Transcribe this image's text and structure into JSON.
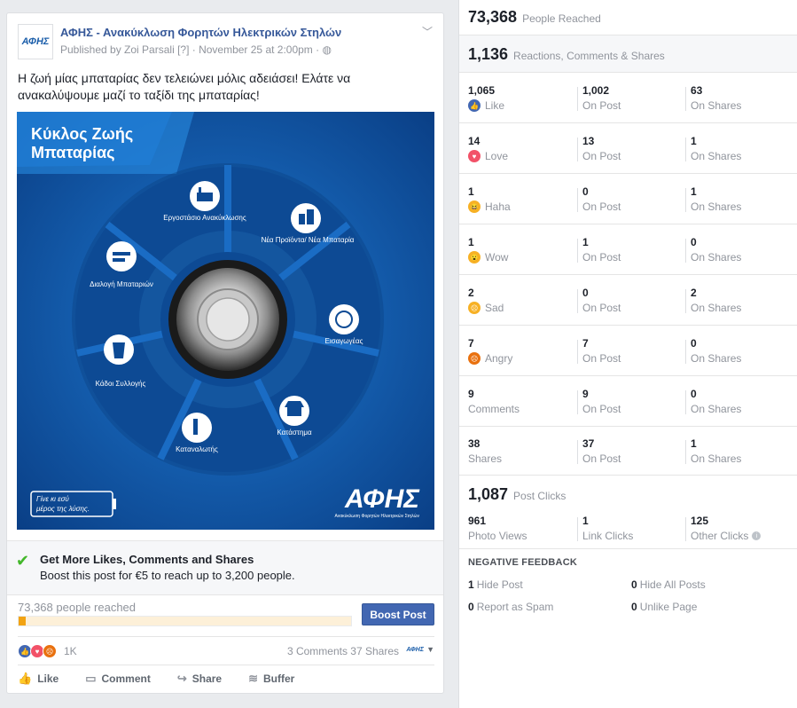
{
  "post": {
    "page_name": "ΑΦΗΣ - Ανακύκλωση Φορητών Ηλεκτρικών Στηλών",
    "avatar_text": "ΑΦΗΣ",
    "meta": "Published by Zoi Parsali [?] · November 25 at 2:00pm · ",
    "text": "Η ζωή μίας μπαταρίας δεν τελειώνει μόλις αδειάσει! Ελάτε να ανακαλύψουμε μαζί το ταξίδι της μπαταρίας!",
    "image": {
      "title_line1": "Κύκλος Ζωής",
      "title_line2": "Μπαταρίας",
      "segments": [
        "Εργοστάσιο Ανακύκλωσης",
        "Νέα Προϊόντα/ Νέα Μπαταρία",
        "Εισαγωγέας",
        "Κατάστημα",
        "Καταναλωτής",
        "Κάδοι Συλλογής",
        "Διαλογή Μπαταριών"
      ],
      "slogan_line1": "Γίνε κι εσύ",
      "slogan_line2": "μέρος της λύσης.",
      "logo": "ΑΦΗΣ",
      "logo_sub": "Ανακύκλωση Φορητών Ηλεκτρικών Στηλών"
    },
    "boost": {
      "title": "Get More Likes, Comments and Shares",
      "desc": "Boost this post for €5 to reach up to 3,200 people."
    },
    "reach_text": "73,368 people reached",
    "reach_fraction": 0.02,
    "boost_button": "Boost Post",
    "reaction_count": "1K",
    "comments_shares": "3 Comments  37 Shares",
    "actions": {
      "like": "Like",
      "comment": "Comment",
      "share": "Share",
      "buffer": "Buffer"
    }
  },
  "stats": {
    "people_reached": {
      "num": "73,368",
      "label": "People Reached"
    },
    "engagement": {
      "num": "1,136",
      "label": "Reactions, Comments & Shares"
    },
    "rows": [
      {
        "total": "1,065",
        "label": "Like",
        "on_post": "1,002",
        "on_post_label": "On Post",
        "on_shares": "63",
        "on_shares_label": "On Shares",
        "emoji": "like-icon",
        "color": "#4267b2"
      },
      {
        "total": "14",
        "label": "Love",
        "on_post": "13",
        "on_post_label": "On Post",
        "on_shares": "1",
        "on_shares_label": "On Shares",
        "emoji": "love-icon",
        "color": "#f25268"
      },
      {
        "total": "1",
        "label": "Haha",
        "on_post": "0",
        "on_post_label": "On Post",
        "on_shares": "1",
        "on_shares_label": "On Shares",
        "emoji": "haha-icon",
        "color": "#f7b125"
      },
      {
        "total": "1",
        "label": "Wow",
        "on_post": "1",
        "on_post_label": "On Post",
        "on_shares": "0",
        "on_shares_label": "On Shares",
        "emoji": "wow-icon",
        "color": "#f7b125"
      },
      {
        "total": "2",
        "label": "Sad",
        "on_post": "0",
        "on_post_label": "On Post",
        "on_shares": "2",
        "on_shares_label": "On Shares",
        "emoji": "sad-icon",
        "color": "#f7b125"
      },
      {
        "total": "7",
        "label": "Angry",
        "on_post": "7",
        "on_post_label": "On Post",
        "on_shares": "0",
        "on_shares_label": "On Shares",
        "emoji": "angry-icon",
        "color": "#e9710f"
      },
      {
        "total": "9",
        "label": "Comments",
        "on_post": "9",
        "on_post_label": "On Post",
        "on_shares": "0",
        "on_shares_label": "On Shares"
      },
      {
        "total": "38",
        "label": "Shares",
        "on_post": "37",
        "on_post_label": "On Post",
        "on_shares": "1",
        "on_shares_label": "On Shares"
      }
    ],
    "post_clicks": {
      "num": "1,087",
      "label": "Post Clicks"
    },
    "clicks": [
      {
        "num": "961",
        "label": "Photo Views"
      },
      {
        "num": "1",
        "label": "Link Clicks"
      },
      {
        "num": "125",
        "label": "Other Clicks"
      }
    ],
    "negative": {
      "title": "NEGATIVE FEEDBACK",
      "items": [
        {
          "num": "1",
          "label": "Hide Post"
        },
        {
          "num": "0",
          "label": "Hide All Posts"
        },
        {
          "num": "0",
          "label": "Report as Spam"
        },
        {
          "num": "0",
          "label": "Unlike Page"
        }
      ]
    }
  }
}
